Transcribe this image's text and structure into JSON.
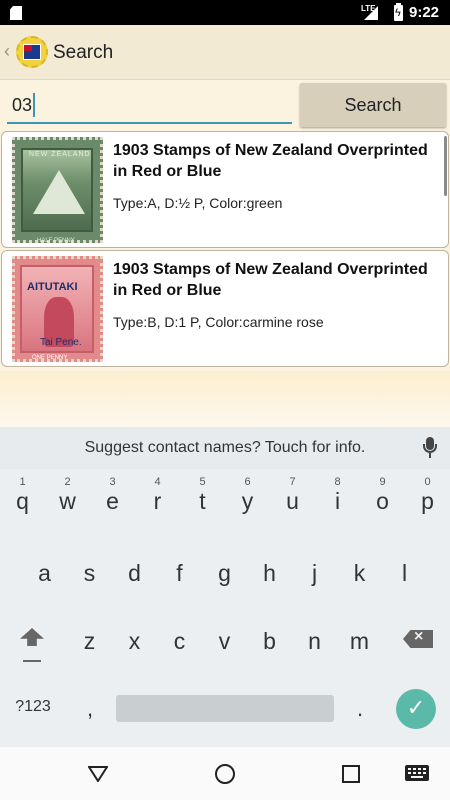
{
  "status_bar": {
    "network": "LTE",
    "time": "9:22"
  },
  "action_bar": {
    "title": "Search",
    "back_icon": "chevron-left-icon",
    "app_icon": "new-zealand-flag-stamp-icon"
  },
  "search": {
    "query": "03",
    "button_label": "Search"
  },
  "results": [
    {
      "title": "1903 Stamps of New Zealand Overprinted in Red or Blue",
      "details": "Type:A, D:½ P, Color:green",
      "stamp_color": "#6d8f6b"
    },
    {
      "title": "1903 Stamps of New Zealand Overprinted in Red or Blue",
      "details": "Type:B, D:1 P, Color:carmine rose",
      "stamp_color": "#e48e95",
      "stamp_overprint": "AITUTAKI",
      "stamp_overprint_value": "Tai Pene."
    }
  ],
  "keyboard": {
    "suggestion": "Suggest contact names? Touch for info.",
    "row1": [
      {
        "hint": "1",
        "char": "q"
      },
      {
        "hint": "2",
        "char": "w"
      },
      {
        "hint": "3",
        "char": "e"
      },
      {
        "hint": "4",
        "char": "r"
      },
      {
        "hint": "5",
        "char": "t"
      },
      {
        "hint": "6",
        "char": "y"
      },
      {
        "hint": "7",
        "char": "u"
      },
      {
        "hint": "8",
        "char": "i"
      },
      {
        "hint": "9",
        "char": "o"
      },
      {
        "hint": "0",
        "char": "p"
      }
    ],
    "row2": [
      "a",
      "s",
      "d",
      "f",
      "g",
      "h",
      "j",
      "k",
      "l"
    ],
    "row3": [
      "z",
      "x",
      "c",
      "v",
      "b",
      "n",
      "m"
    ],
    "symbols_label": "?123",
    "comma": ",",
    "period": ".",
    "accent_color": "#5ab9a8"
  }
}
